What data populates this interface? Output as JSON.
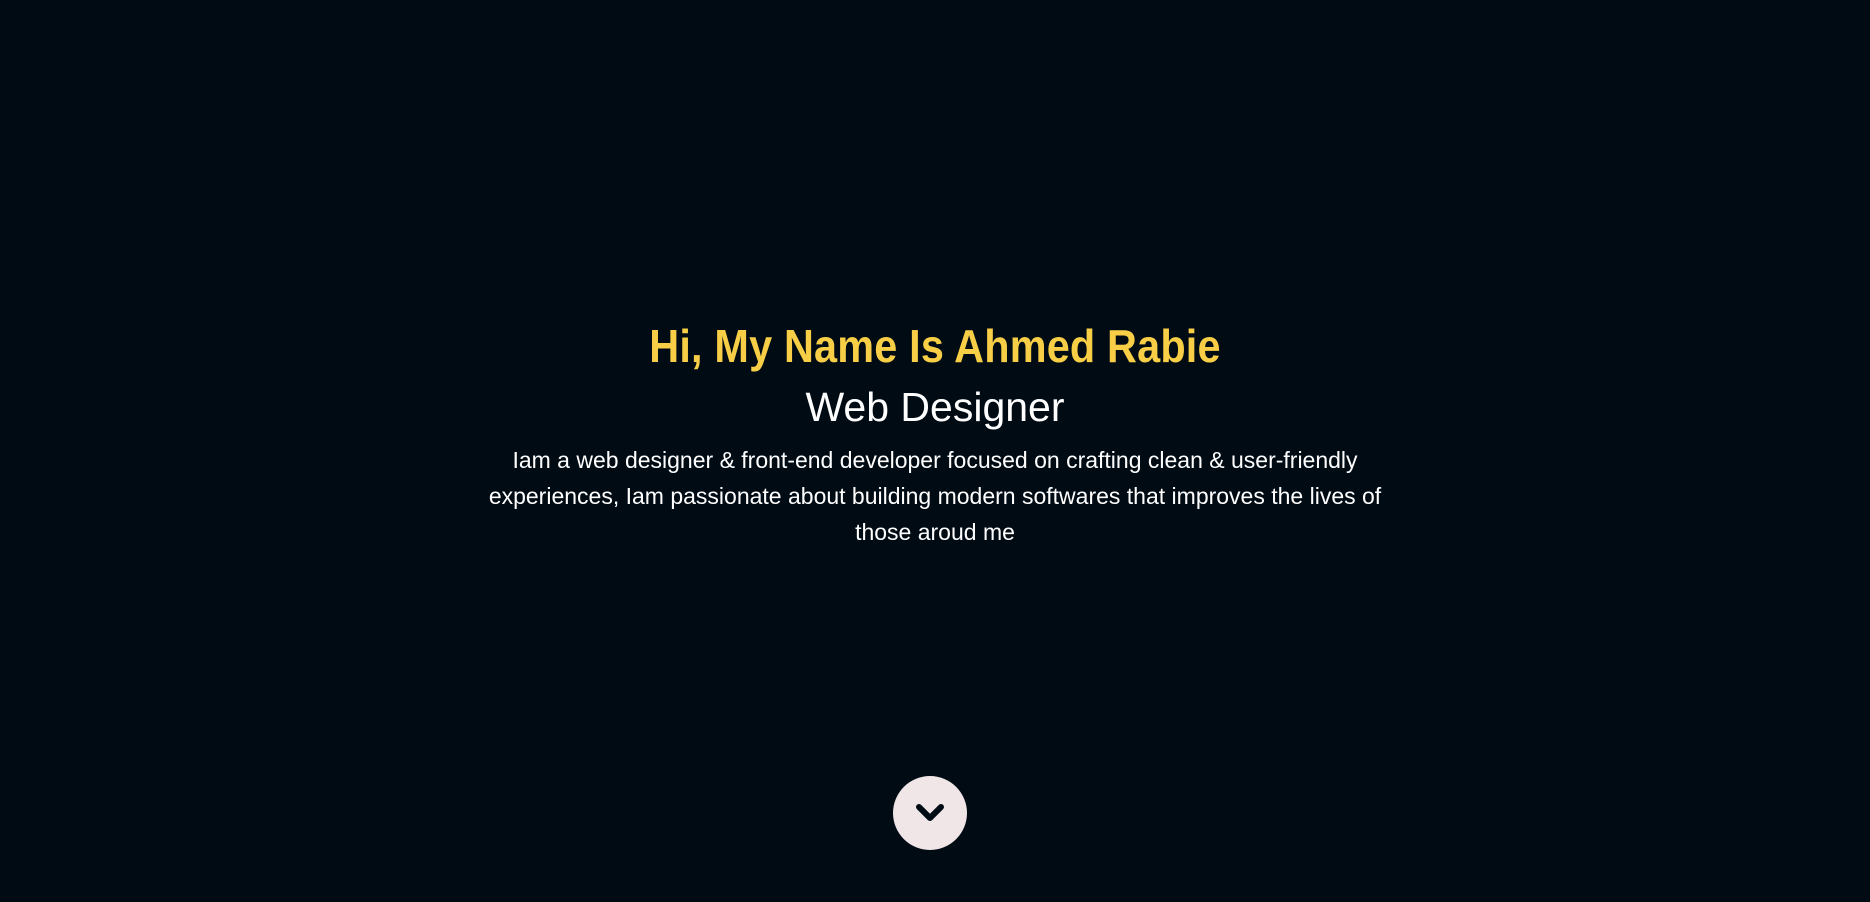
{
  "hero": {
    "greeting": "Hi, My Name Is Ahmed Rabie",
    "role": "Web Designer",
    "bio": "Iam a web designer & front-end developer focused on crafting clean & user-friendly experiences, Iam passionate about building modern softwares that improves the lives of those aroud me"
  },
  "scroll_button": {
    "icon": "chevron-down-icon"
  },
  "colors": {
    "background": "#010b14",
    "accent": "#f7ce46",
    "text": "#ffffff",
    "button_bg": "#f0e6e7",
    "icon": "#010b14"
  }
}
